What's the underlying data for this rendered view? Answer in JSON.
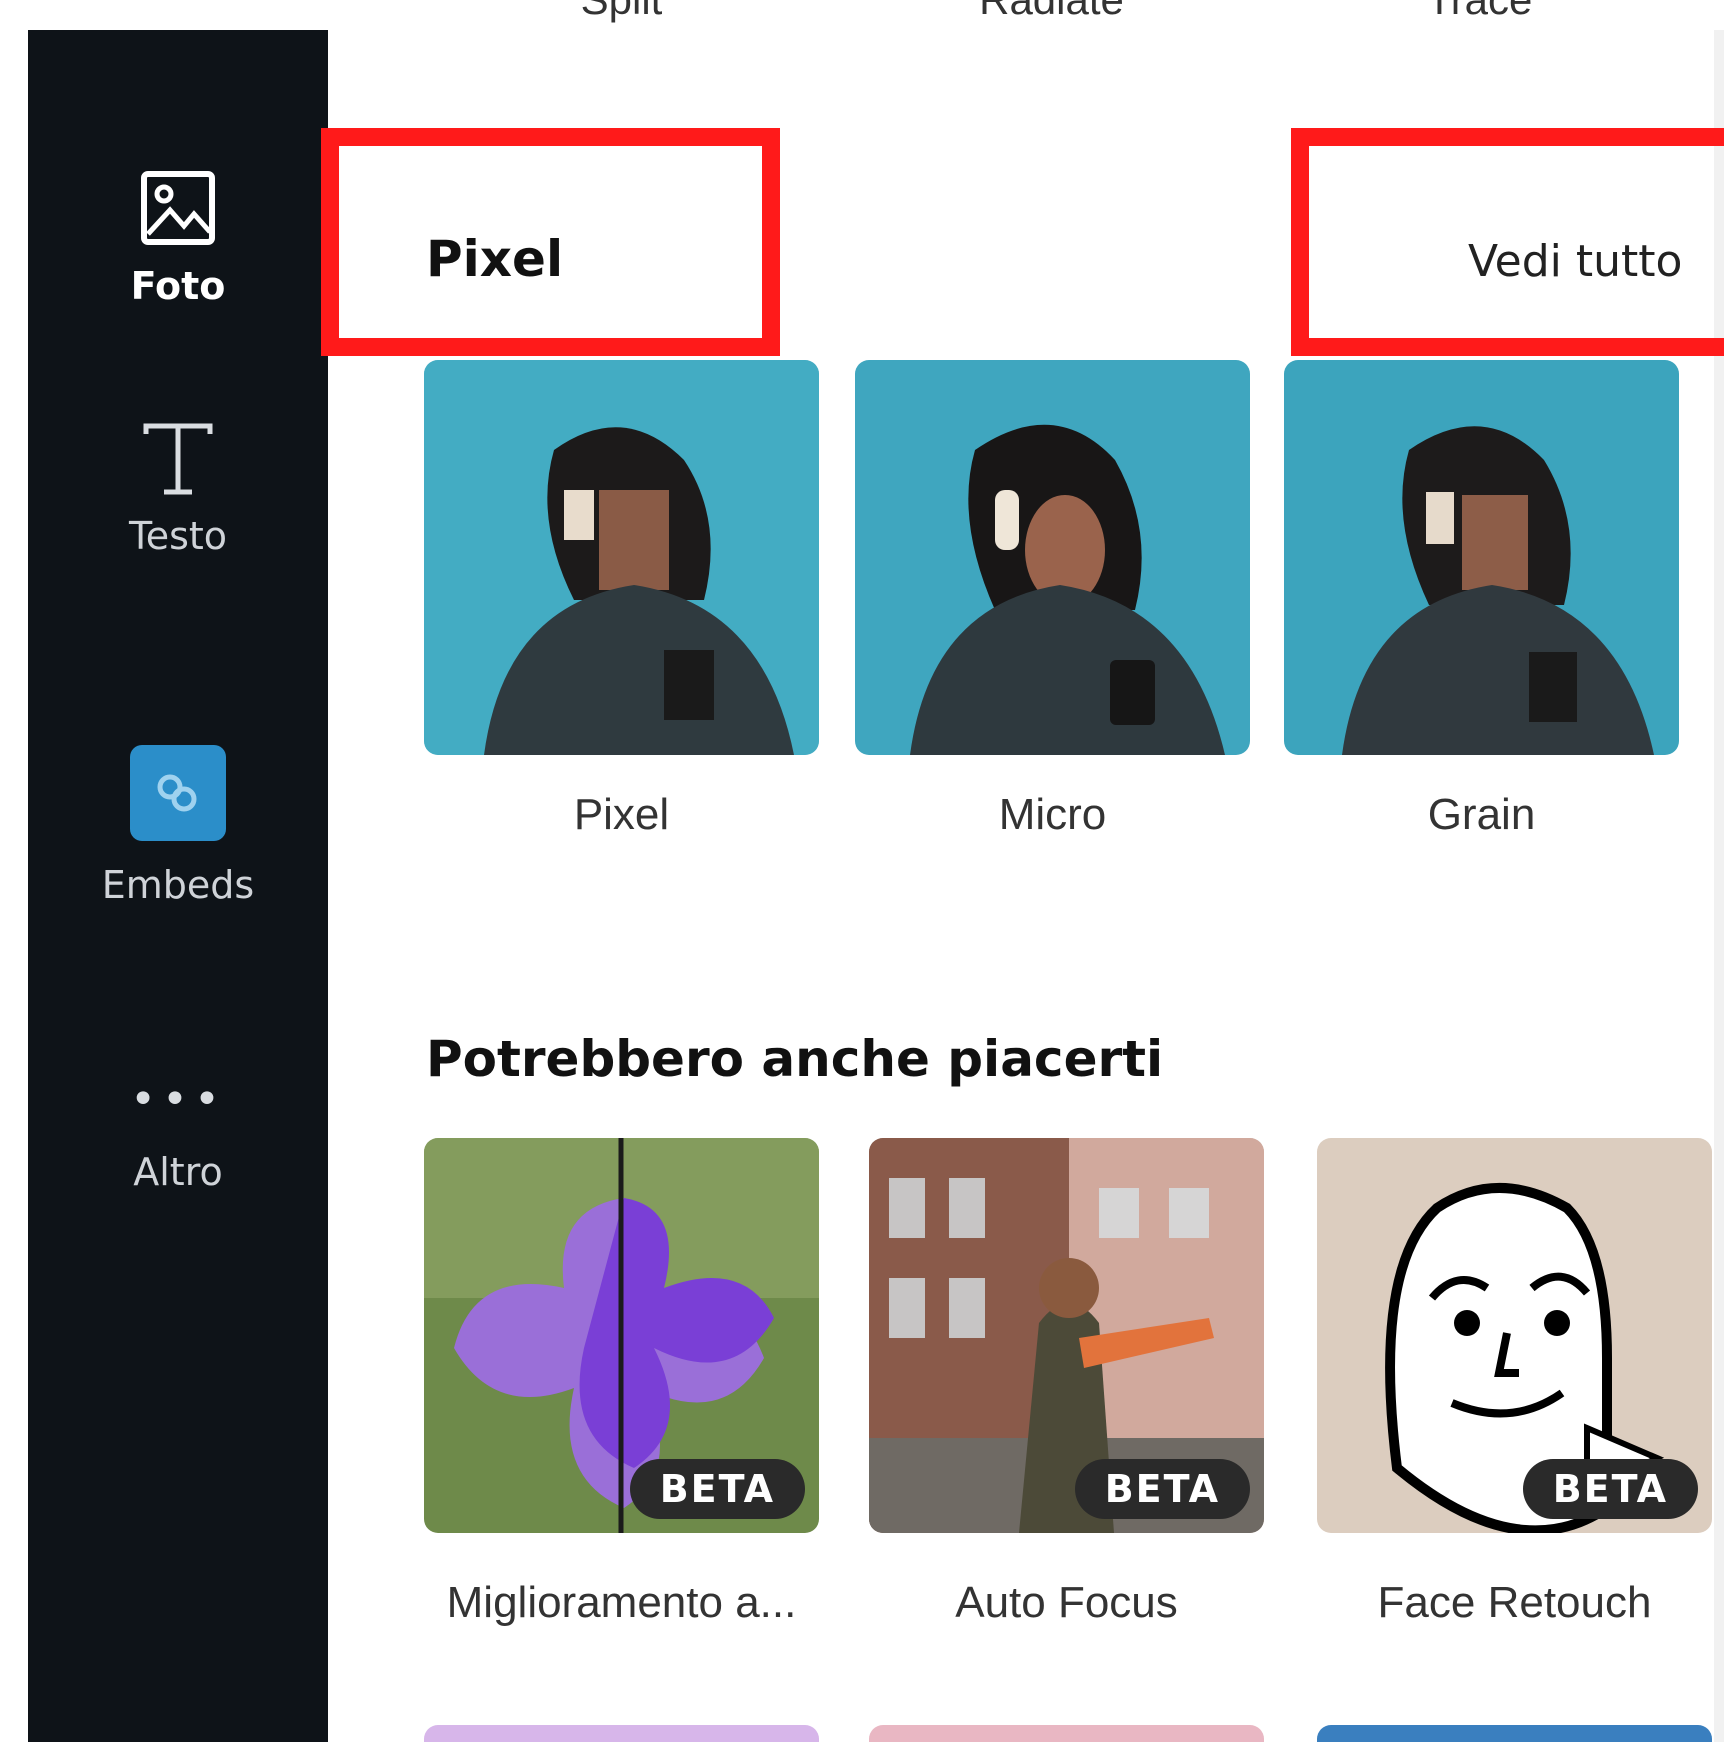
{
  "sidebar": {
    "items": [
      {
        "label": "Foto",
        "icon": "photo-icon",
        "active": true
      },
      {
        "label": "Testo",
        "icon": "text-icon",
        "active": false
      },
      {
        "label": "Embeds",
        "icon": "embeds-icon",
        "active": false
      },
      {
        "label": "Altro",
        "icon": "more-dots-icon",
        "active": false
      }
    ]
  },
  "top_row": {
    "labels": [
      "Split",
      "Radiate",
      "Trace"
    ]
  },
  "pixel_section": {
    "title": "Pixel",
    "see_all": "Vedi tutto",
    "cards": [
      {
        "label": "Pixel"
      },
      {
        "label": "Micro"
      },
      {
        "label": "Grain"
      }
    ]
  },
  "suggest_section": {
    "title": "Potrebbero anche piacerti",
    "cards": [
      {
        "label": "Miglioramento a...",
        "badge": "BETA"
      },
      {
        "label": "Auto Focus",
        "badge": "BETA"
      },
      {
        "label": "Face Retouch",
        "badge": "BETA"
      }
    ]
  },
  "colors": {
    "sidebar_bg": "#0e1318",
    "highlight": "#ff1a1a",
    "embeds_accent": "#2b8ec9"
  }
}
